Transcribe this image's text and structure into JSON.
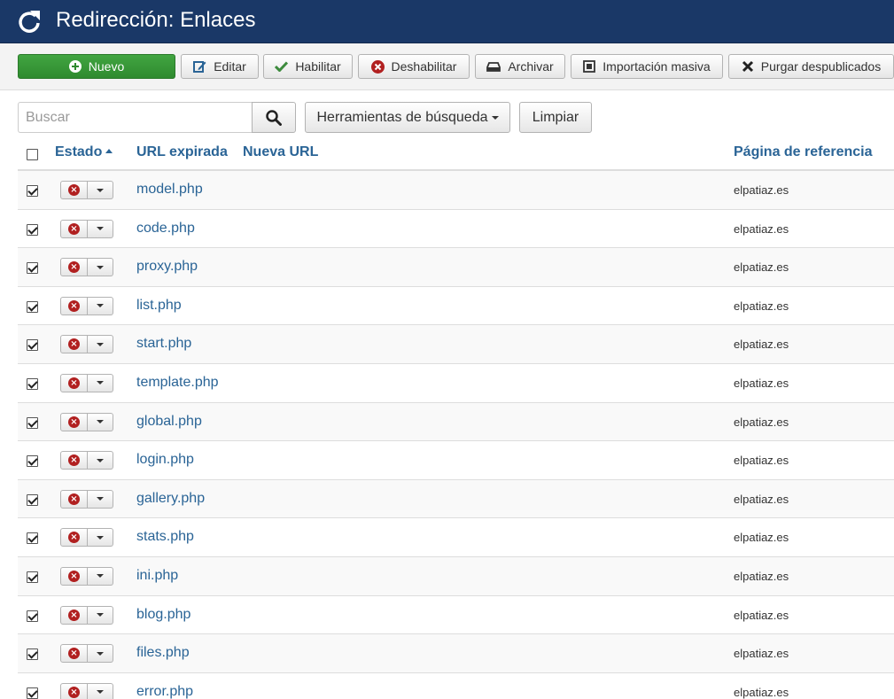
{
  "header": {
    "title": "Redirección: Enlaces",
    "icon": "refresh-icon"
  },
  "toolbar": {
    "new_label": "Nuevo",
    "edit_label": "Editar",
    "enable_label": "Habilitar",
    "disable_label": "Deshabilitar",
    "archive_label": "Archivar",
    "bulk_import_label": "Importación masiva",
    "purge_label": "Purgar despublicados"
  },
  "search": {
    "placeholder": "Buscar",
    "tools_label": "Herramientas de búsqueda",
    "clear_label": "Limpiar"
  },
  "table": {
    "columns": {
      "status": "Estado",
      "expired_url": "URL expirada",
      "new_url": "Nueva URL",
      "referer": "Página de referencia"
    },
    "rows": [
      {
        "url": "model.php",
        "referer": "elpatiaz.es",
        "checked": true
      },
      {
        "url": "code.php",
        "referer": "elpatiaz.es",
        "checked": true
      },
      {
        "url": "proxy.php",
        "referer": "elpatiaz.es",
        "checked": true
      },
      {
        "url": "list.php",
        "referer": "elpatiaz.es",
        "checked": true
      },
      {
        "url": "start.php",
        "referer": "elpatiaz.es",
        "checked": true
      },
      {
        "url": "template.php",
        "referer": "elpatiaz.es",
        "checked": true
      },
      {
        "url": "global.php",
        "referer": "elpatiaz.es",
        "checked": true
      },
      {
        "url": "login.php",
        "referer": "elpatiaz.es",
        "checked": true
      },
      {
        "url": "gallery.php",
        "referer": "elpatiaz.es",
        "checked": true
      },
      {
        "url": "stats.php",
        "referer": "elpatiaz.es",
        "checked": true
      },
      {
        "url": "ini.php",
        "referer": "elpatiaz.es",
        "checked": true
      },
      {
        "url": "blog.php",
        "referer": "elpatiaz.es",
        "checked": true
      },
      {
        "url": "files.php",
        "referer": "elpatiaz.es",
        "checked": true
      },
      {
        "url": "error.php",
        "referer": "elpatiaz.es",
        "checked": true
      }
    ]
  },
  "colors": {
    "header_bg": "#1a3867",
    "new_button": "#3a9d3a",
    "link": "#2a6496",
    "disabled_status": "#b12020"
  }
}
